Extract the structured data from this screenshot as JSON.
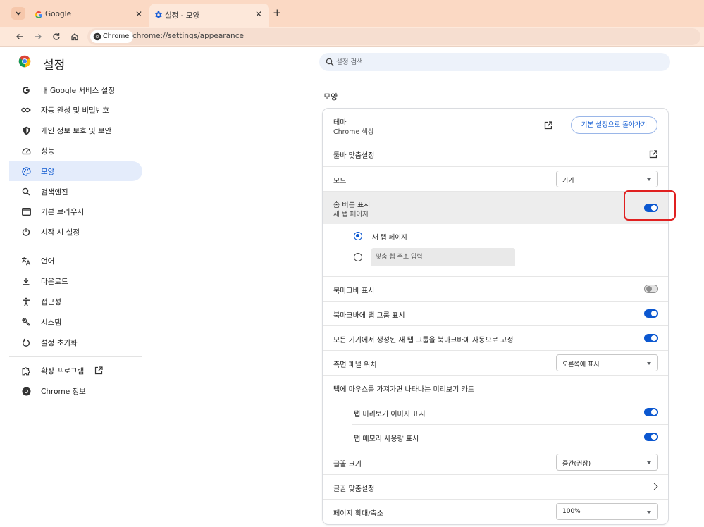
{
  "browser": {
    "tabs": [
      {
        "title": "Google",
        "active": false
      },
      {
        "title": "설정 - 모양",
        "active": true
      }
    ],
    "chip_label": "Chrome",
    "url": "chrome://settings/appearance"
  },
  "sidebar": {
    "title": "설정",
    "items": [
      {
        "label": "내 Google 서비스 설정",
        "icon": "google-g-icon"
      },
      {
        "label": "자동 완성 및 비밀번호",
        "icon": "key-icon"
      },
      {
        "label": "개인 정보 보호 및 보안",
        "icon": "shield-icon"
      },
      {
        "label": "성능",
        "icon": "speedometer-icon"
      },
      {
        "label": "모양",
        "icon": "palette-icon",
        "active": true
      },
      {
        "label": "검색엔진",
        "icon": "search-icon"
      },
      {
        "label": "기본 브라우저",
        "icon": "browser-window-icon"
      },
      {
        "label": "시작 시 설정",
        "icon": "power-icon"
      },
      {
        "label": "언어",
        "icon": "translate-icon"
      },
      {
        "label": "다운로드",
        "icon": "download-icon"
      },
      {
        "label": "접근성",
        "icon": "accessibility-icon"
      },
      {
        "label": "시스템",
        "icon": "wrench-icon"
      },
      {
        "label": "설정 초기화",
        "icon": "reset-icon"
      },
      {
        "label": "확장 프로그램",
        "icon": "puzzle-icon"
      },
      {
        "label": "Chrome 정보",
        "icon": "chrome-logo-icon"
      }
    ]
  },
  "search": {
    "placeholder": "설정 검색"
  },
  "section": {
    "title": "모양"
  },
  "settings": {
    "theme": {
      "label": "테마",
      "sub": "Chrome 색상",
      "reset_label": "기본 설정으로 돌아가기"
    },
    "toolbar_custom": {
      "label": "툴바 맞춤설정"
    },
    "mode": {
      "label": "모드",
      "value": "기기"
    },
    "home_button": {
      "label": "홈 버튼 표시",
      "sub": "새 탭 페이지",
      "enabled": true
    },
    "home_new_tab": {
      "label": "새 탭 페이지",
      "selected": true
    },
    "home_custom_url": {
      "placeholder": "맞춤 웹 주소 입력"
    },
    "bookmarks_bar": {
      "label": "북마크바 표시",
      "enabled": false
    },
    "bookmarks_tab_groups": {
      "label": "북마크바에 탭 그룹 표시",
      "enabled": true
    },
    "pin_tab_groups": {
      "label": "모든 기기에서 생성된 새 탭 그룹을 북마크바에 자동으로 고정",
      "enabled": true
    },
    "side_panel": {
      "label": "측면 패널 위치",
      "value": "오른쪽에 표시"
    },
    "hover_card": {
      "label": "탭에 마우스를 가져가면 나타나는 미리보기 카드"
    },
    "hover_image": {
      "label": "탭 미리보기 이미지 표시",
      "enabled": true
    },
    "hover_memory": {
      "label": "탭 메모리 사용량 표시",
      "enabled": true
    },
    "font_size": {
      "label": "글꼴 크기",
      "value": "중간(권장)"
    },
    "font_custom": {
      "label": "글꼴 맞춤설정"
    },
    "page_zoom": {
      "label": "페이지 확대/축소",
      "value": "100%"
    }
  },
  "colors": {
    "accent": "#0b57d0",
    "highlight": "#e02020",
    "tabstrip": "#fbd9c4"
  }
}
